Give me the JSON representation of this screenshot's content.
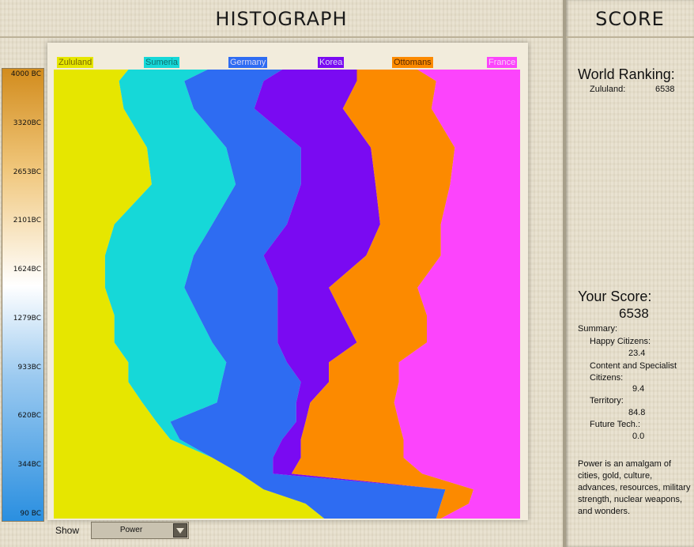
{
  "window": {
    "histograph_title": "HISTOGRAPH",
    "score_title": "SCORE"
  },
  "colors": {
    "zululand": "#e6e600",
    "sumeria": "#16d8d8",
    "germany": "#2e6cf2",
    "korea": "#7a0af2",
    "ottomans": "#fc8a00",
    "france": "#fc44fc"
  },
  "chart_data": {
    "type": "area",
    "stacked": true,
    "normalized": true,
    "orientation": "vertical-time",
    "series": [
      {
        "name": "Zululand",
        "color": "#e6e600"
      },
      {
        "name": "Sumeria",
        "color": "#16d8d8"
      },
      {
        "name": "Germany",
        "color": "#2e6cf2"
      },
      {
        "name": "Korea",
        "color": "#7a0af2"
      },
      {
        "name": "Ottomans",
        "color": "#fc8a00"
      },
      {
        "name": "France",
        "color": "#fc44fc"
      }
    ],
    "time_ticks": [
      "4000 BC",
      "3320BC",
      "2653BC",
      "2101BC",
      "1624BC",
      "1279BC",
      "933BC",
      "620BC",
      "344BC",
      "90 BC"
    ],
    "time_values": [
      -4000,
      -3320,
      -2653,
      -2101,
      -1624,
      -1279,
      -933,
      -620,
      -344,
      -90
    ],
    "share_boundaries": {
      "comment_free": "",
      "rows": [
        [
          -4000,
          0.16,
          0.33,
          0.49,
          0.65,
          0.78
        ],
        [
          -3900,
          0.14,
          0.28,
          0.45,
          0.65,
          0.82
        ],
        [
          -3660,
          0.15,
          0.3,
          0.43,
          0.62,
          0.81
        ],
        [
          -3320,
          0.2,
          0.37,
          0.53,
          0.68,
          0.86
        ],
        [
          -3000,
          0.21,
          0.39,
          0.53,
          0.69,
          0.85
        ],
        [
          -2653,
          0.13,
          0.34,
          0.5,
          0.7,
          0.83
        ],
        [
          -2380,
          0.11,
          0.3,
          0.45,
          0.67,
          0.83
        ],
        [
          -2101,
          0.11,
          0.28,
          0.48,
          0.59,
          0.78
        ],
        [
          -1860,
          0.13,
          0.31,
          0.48,
          0.62,
          0.8
        ],
        [
          -1624,
          0.13,
          0.34,
          0.48,
          0.65,
          0.8
        ],
        [
          -1450,
          0.16,
          0.37,
          0.5,
          0.59,
          0.74
        ],
        [
          -1279,
          0.16,
          0.36,
          0.53,
          0.59,
          0.74
        ],
        [
          -1100,
          0.19,
          0.35,
          0.52,
          0.55,
          0.73
        ],
        [
          -933,
          0.22,
          0.25,
          0.52,
          0.54,
          0.74
        ],
        [
          -780,
          0.25,
          0.27,
          0.49,
          0.53,
          0.75
        ],
        [
          -620,
          0.34,
          0.34,
          0.47,
          0.53,
          0.75
        ],
        [
          -480,
          0.4,
          0.4,
          0.47,
          0.51,
          0.79
        ],
        [
          -344,
          0.45,
          0.45,
          0.84,
          0.84,
          0.9
        ],
        [
          -220,
          0.54,
          0.54,
          0.83,
          0.83,
          0.89
        ],
        [
          -90,
          0.58,
          0.58,
          0.82,
          0.82,
          0.83
        ]
      ]
    },
    "show_metric": "Power"
  },
  "controls": {
    "show_label": "Show",
    "show_value": "Power"
  },
  "score_panel": {
    "world_ranking_title": "World Ranking:",
    "ranking": [
      {
        "name": "Zululand:",
        "score": "6538"
      }
    ],
    "your_score_title": "Your Score:",
    "your_score_value": "6538",
    "summary_title": "Summary:",
    "summary_items": [
      {
        "label": "Happy Citizens:",
        "value": "23.4"
      },
      {
        "label": "Content and Specialist Citizens:",
        "value": "9.4"
      },
      {
        "label": "Territory:",
        "value": "84.8"
      },
      {
        "label": "Future Tech.:",
        "value": "0.0"
      }
    ],
    "description": "Power is an amalgam of cities, gold, culture, advances, resources, military strength, nuclear weapons, and wonders."
  }
}
